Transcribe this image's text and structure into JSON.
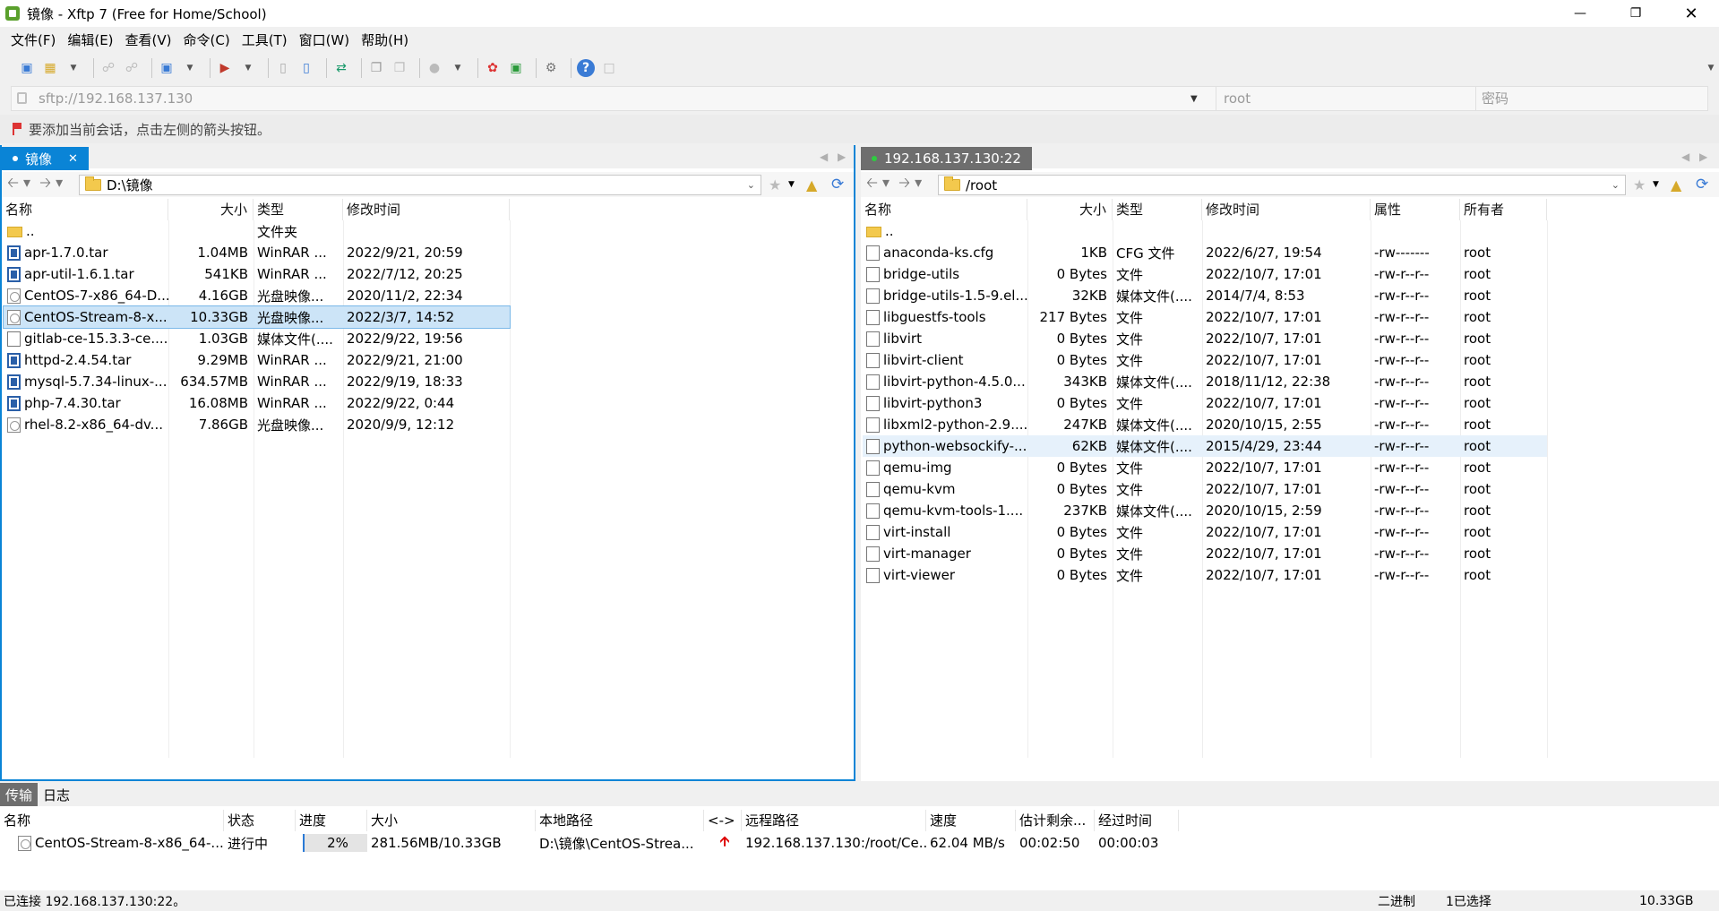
{
  "window": {
    "title": "镜像 - Xftp 7 (Free for Home/School)"
  },
  "menu": [
    "文件(F)",
    "编辑(E)",
    "查看(V)",
    "命令(C)",
    "工具(T)",
    "窗口(W)",
    "帮助(H)"
  ],
  "address": {
    "url": "sftp://192.168.137.130",
    "user_placeholder": "root",
    "password_placeholder": "密码"
  },
  "hint": "要添加当前会话，点击左侧的箭头按钮。",
  "left": {
    "tab": "镜像",
    "path": "D:\\镜像",
    "columns": [
      "名称",
      "大小",
      "类型",
      "修改时间"
    ],
    "rows": [
      {
        "icon": "folder",
        "name": "..",
        "size": "",
        "type": "文件夹",
        "date": ""
      },
      {
        "icon": "rar",
        "name": "apr-1.7.0.tar",
        "size": "1.04MB",
        "type": "WinRAR ...",
        "date": "2022/9/21, 20:59"
      },
      {
        "icon": "rar",
        "name": "apr-util-1.6.1.tar",
        "size": "541KB",
        "type": "WinRAR ...",
        "date": "2022/7/12, 20:25"
      },
      {
        "icon": "iso",
        "name": "CentOS-7-x86_64-D...",
        "size": "4.16GB",
        "type": "光盘映像...",
        "date": "2020/11/2, 22:34"
      },
      {
        "icon": "iso",
        "name": "CentOS-Stream-8-x...",
        "size": "10.33GB",
        "type": "光盘映像...",
        "date": "2022/3/7, 14:52"
      },
      {
        "icon": "doc",
        "name": "gitlab-ce-15.3.3-ce....",
        "size": "1.03GB",
        "type": "媒体文件(....",
        "date": "2022/9/22, 19:56"
      },
      {
        "icon": "rar",
        "name": "httpd-2.4.54.tar",
        "size": "9.29MB",
        "type": "WinRAR ...",
        "date": "2022/9/21, 21:00"
      },
      {
        "icon": "rar",
        "name": "mysql-5.7.34-linux-...",
        "size": "634.57MB",
        "type": "WinRAR ...",
        "date": "2022/9/19, 18:33"
      },
      {
        "icon": "rar",
        "name": "php-7.4.30.tar",
        "size": "16.08MB",
        "type": "WinRAR ...",
        "date": "2022/9/22, 0:44"
      },
      {
        "icon": "iso",
        "name": "rhel-8.2-x86_64-dv...",
        "size": "7.86GB",
        "type": "光盘映像...",
        "date": "2020/9/9, 12:12"
      }
    ]
  },
  "right": {
    "tab": "192.168.137.130:22",
    "path": "/root",
    "columns": [
      "名称",
      "大小",
      "类型",
      "修改时间",
      "属性",
      "所有者"
    ],
    "rows": [
      {
        "icon": "folder",
        "name": "..",
        "size": "",
        "type": "",
        "date": "",
        "attr": "",
        "owner": ""
      },
      {
        "icon": "doc",
        "name": "anaconda-ks.cfg",
        "size": "1KB",
        "type": "CFG 文件",
        "date": "2022/6/27, 19:54",
        "attr": "-rw-------",
        "owner": "root"
      },
      {
        "icon": "doc",
        "name": "bridge-utils",
        "size": "0 Bytes",
        "type": "文件",
        "date": "2022/10/7, 17:01",
        "attr": "-rw-r--r--",
        "owner": "root"
      },
      {
        "icon": "doc",
        "name": "bridge-utils-1.5-9.el...",
        "size": "32KB",
        "type": "媒体文件(....",
        "date": "2014/7/4, 8:53",
        "attr": "-rw-r--r--",
        "owner": "root"
      },
      {
        "icon": "doc",
        "name": "libguestfs-tools",
        "size": "217 Bytes",
        "type": "文件",
        "date": "2022/10/7, 17:01",
        "attr": "-rw-r--r--",
        "owner": "root"
      },
      {
        "icon": "doc",
        "name": "libvirt",
        "size": "0 Bytes",
        "type": "文件",
        "date": "2022/10/7, 17:01",
        "attr": "-rw-r--r--",
        "owner": "root"
      },
      {
        "icon": "doc",
        "name": "libvirt-client",
        "size": "0 Bytes",
        "type": "文件",
        "date": "2022/10/7, 17:01",
        "attr": "-rw-r--r--",
        "owner": "root"
      },
      {
        "icon": "doc",
        "name": "libvirt-python-4.5.0...",
        "size": "343KB",
        "type": "媒体文件(....",
        "date": "2018/11/12, 22:38",
        "attr": "-rw-r--r--",
        "owner": "root"
      },
      {
        "icon": "doc",
        "name": "libvirt-python3",
        "size": "0 Bytes",
        "type": "文件",
        "date": "2022/10/7, 17:01",
        "attr": "-rw-r--r--",
        "owner": "root"
      },
      {
        "icon": "doc",
        "name": "libxml2-python-2.9....",
        "size": "247KB",
        "type": "媒体文件(....",
        "date": "2020/10/15, 2:55",
        "attr": "-rw-r--r--",
        "owner": "root"
      },
      {
        "icon": "doc",
        "name": "python-websockify-...",
        "size": "62KB",
        "type": "媒体文件(....",
        "date": "2015/4/29, 23:44",
        "attr": "-rw-r--r--",
        "owner": "root"
      },
      {
        "icon": "doc",
        "name": "qemu-img",
        "size": "0 Bytes",
        "type": "文件",
        "date": "2022/10/7, 17:01",
        "attr": "-rw-r--r--",
        "owner": "root"
      },
      {
        "icon": "doc",
        "name": "qemu-kvm",
        "size": "0 Bytes",
        "type": "文件",
        "date": "2022/10/7, 17:01",
        "attr": "-rw-r--r--",
        "owner": "root"
      },
      {
        "icon": "doc",
        "name": "qemu-kvm-tools-1....",
        "size": "237KB",
        "type": "媒体文件(....",
        "date": "2020/10/15, 2:59",
        "attr": "-rw-r--r--",
        "owner": "root"
      },
      {
        "icon": "doc",
        "name": "virt-install",
        "size": "0 Bytes",
        "type": "文件",
        "date": "2022/10/7, 17:01",
        "attr": "-rw-r--r--",
        "owner": "root"
      },
      {
        "icon": "doc",
        "name": "virt-manager",
        "size": "0 Bytes",
        "type": "文件",
        "date": "2022/10/7, 17:01",
        "attr": "-rw-r--r--",
        "owner": "root"
      },
      {
        "icon": "doc",
        "name": "virt-viewer",
        "size": "0 Bytes",
        "type": "文件",
        "date": "2022/10/7, 17:01",
        "attr": "-rw-r--r--",
        "owner": "root"
      }
    ]
  },
  "transfer": {
    "tabs": [
      "传输",
      "日志"
    ],
    "columns": [
      "名称",
      "状态",
      "进度",
      "大小",
      "本地路径",
      "<->",
      "远程路径",
      "速度",
      "估计剩余...",
      "经过时间"
    ],
    "row": {
      "name": "CentOS-Stream-8-x86_64-...",
      "status": "进行中",
      "progress": "2%",
      "size": "281.56MB/10.33GB",
      "local": "D:\\镜像\\CentOS-Strea...",
      "remote": "192.168.137.130:/root/Ce...",
      "speed": "62.04 MB/s",
      "remaining": "00:02:50",
      "elapsed": "00:00:03"
    }
  },
  "status": {
    "connected": "已连接 192.168.137.130:22。",
    "mode": "二进制",
    "selected": "1已选择",
    "size": "10.33GB"
  }
}
